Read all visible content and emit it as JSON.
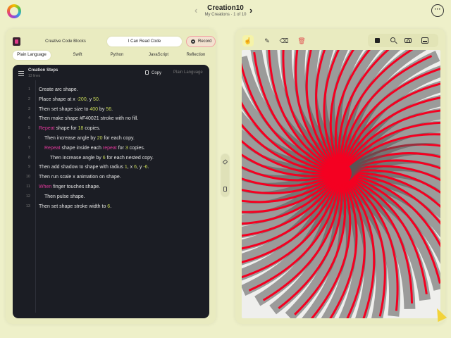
{
  "header": {
    "title": "Creation10",
    "subtitle": "My Creations · 1 of 10",
    "prev_label": "‹",
    "next_label": "›",
    "more_label": "···"
  },
  "mode_tabs": {
    "blocks": "Creative Code Blocks",
    "read": "I Can Read Code",
    "record": "Record"
  },
  "languages": [
    {
      "label": "Plain Language",
      "active": true
    },
    {
      "label": "Swift",
      "active": false
    },
    {
      "label": "Python",
      "active": false
    },
    {
      "label": "JavaScript",
      "active": false
    },
    {
      "label": "Reflection",
      "active": false
    }
  ],
  "code_panel": {
    "title": "Creation Steps",
    "count": "13 lines",
    "copy_label": "Copy",
    "language_label": "Plain Language"
  },
  "code_lines": [
    {
      "num": "1",
      "indent": 0,
      "parts": [
        {
          "t": "Create arc shape.",
          "c": ""
        }
      ]
    },
    {
      "num": "2",
      "indent": 0,
      "parts": [
        {
          "t": "Place shape at x ",
          "c": ""
        },
        {
          "t": "-200",
          "c": "num"
        },
        {
          "t": ", y ",
          "c": ""
        },
        {
          "t": "50",
          "c": "num"
        },
        {
          "t": ".",
          "c": ""
        }
      ]
    },
    {
      "num": "3",
      "indent": 0,
      "parts": [
        {
          "t": "Then set shape size to ",
          "c": ""
        },
        {
          "t": "400",
          "c": "num"
        },
        {
          "t": " by ",
          "c": ""
        },
        {
          "t": "56",
          "c": "num"
        },
        {
          "t": ".",
          "c": ""
        }
      ]
    },
    {
      "num": "4",
      "indent": 0,
      "parts": [
        {
          "t": "Then make shape #F40021 stroke with no fill.",
          "c": ""
        }
      ]
    },
    {
      "num": "5",
      "indent": 0,
      "parts": [
        {
          "t": "Repeat",
          "c": "kw"
        },
        {
          "t": " shape for ",
          "c": ""
        },
        {
          "t": "18",
          "c": "num"
        },
        {
          "t": " copies.",
          "c": ""
        }
      ]
    },
    {
      "num": "6",
      "indent": 1,
      "parts": [
        {
          "t": "Then increase angle by ",
          "c": ""
        },
        {
          "t": "20",
          "c": "num"
        },
        {
          "t": " for each copy.",
          "c": ""
        }
      ]
    },
    {
      "num": "7",
      "indent": 1,
      "parts": [
        {
          "t": "Repeat",
          "c": "kw"
        },
        {
          "t": " shape inside each ",
          "c": ""
        },
        {
          "t": "repeat",
          "c": "kw"
        },
        {
          "t": " for ",
          "c": ""
        },
        {
          "t": "3",
          "c": "num"
        },
        {
          "t": " copies.",
          "c": ""
        }
      ]
    },
    {
      "num": "8",
      "indent": 2,
      "parts": [
        {
          "t": "Then increase angle by ",
          "c": ""
        },
        {
          "t": "6",
          "c": "num"
        },
        {
          "t": " for each nested copy.",
          "c": ""
        }
      ]
    },
    {
      "num": "9",
      "indent": 0,
      "parts": [
        {
          "t": "Then add shadow to shape with radius ",
          "c": ""
        },
        {
          "t": "1",
          "c": "num"
        },
        {
          "t": ", x ",
          "c": ""
        },
        {
          "t": "6",
          "c": "num"
        },
        {
          "t": ", y ",
          "c": ""
        },
        {
          "t": "-6",
          "c": "num"
        },
        {
          "t": ".",
          "c": ""
        }
      ]
    },
    {
      "num": "10",
      "indent": 0,
      "parts": [
        {
          "t": "Then run scale x animation on shape.",
          "c": ""
        }
      ]
    },
    {
      "num": "11",
      "indent": 0,
      "parts": [
        {
          "t": "When",
          "c": "kw"
        },
        {
          "t": " finger touches shape.",
          "c": ""
        }
      ]
    },
    {
      "num": "12",
      "indent": 1,
      "parts": [
        {
          "t": "Then pulse shape.",
          "c": ""
        }
      ]
    },
    {
      "num": "13",
      "indent": 0,
      "parts": [
        {
          "t": "Then set shape stroke width to ",
          "c": ""
        },
        {
          "t": "6",
          "c": "num"
        },
        {
          "t": ".",
          "c": ""
        }
      ]
    }
  ],
  "toolbar": {
    "left_tools": [
      "select-icon",
      "pen-icon",
      "eraser-icon",
      "trash-icon"
    ],
    "right_tools": [
      "stop-icon",
      "zoom-icon",
      "camera-icon",
      "gallery-icon"
    ]
  },
  "artwork": {
    "stroke_color": "#F40021",
    "shadow_color": "#555555",
    "repeat_copies": 18,
    "nested_copies": 3
  },
  "colors": {
    "keyword": "#e0389a",
    "number": "#c7d857",
    "background": "#eef0c9"
  }
}
